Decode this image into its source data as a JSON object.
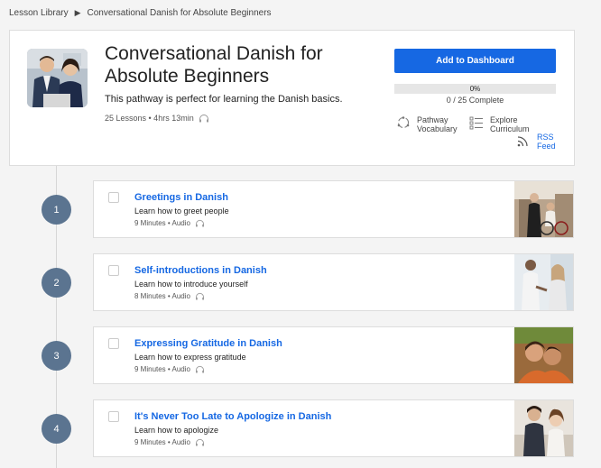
{
  "breadcrumb": {
    "root": "Lesson Library",
    "current": "Conversational Danish for Absolute Beginners"
  },
  "pathway": {
    "title": "Conversational Danish for Absolute Beginners",
    "description": "This pathway is perfect for learning the Danish basics.",
    "meta": "25 Lessons • 4hrs 13min",
    "add_button": "Add to Dashboard",
    "progress_percent": "0%",
    "progress_text": "0 / 25 Complete",
    "vocab_line1": "Pathway",
    "vocab_line2": "Vocabulary",
    "curriculum_line1": "Explore",
    "curriculum_line2": "Curriculum",
    "rss_line1": "RSS",
    "rss_line2": "Feed"
  },
  "colors": {
    "accent": "#1668e3",
    "badge": "#5b7490"
  },
  "lessons": [
    {
      "number": "1",
      "title": "Greetings in Danish",
      "description": "Learn how to greet people",
      "meta": "9 Minutes • Audio"
    },
    {
      "number": "2",
      "title": "Self-introductions in Danish",
      "description": "Learn how to introduce yourself",
      "meta": "8 Minutes • Audio"
    },
    {
      "number": "3",
      "title": "Expressing Gratitude in Danish",
      "description": "Learn how to express gratitude",
      "meta": "9 Minutes • Audio"
    },
    {
      "number": "4",
      "title": "It's Never Too Late to Apologize in Danish",
      "description": "Learn how to apologize",
      "meta": "9 Minutes • Audio"
    }
  ]
}
